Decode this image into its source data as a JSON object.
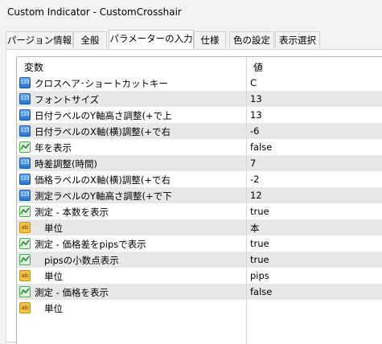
{
  "window": {
    "title": "Custom Indicator - CustomCrosshair"
  },
  "tabs": [
    {
      "label": "パージョン情報"
    },
    {
      "label": "全般"
    },
    {
      "label": "パラメーターの入力",
      "active": true
    },
    {
      "label": "仕様"
    },
    {
      "label": "色の設定"
    },
    {
      "label": "表示選択"
    }
  ],
  "grid": {
    "header_name": "変数",
    "header_value": "値",
    "rows": [
      {
        "type": "num",
        "name": "クロスヘア･ショートカットキー",
        "value": "C",
        "alt": false,
        "indent": false
      },
      {
        "type": "num",
        "name": "フォントサイズ",
        "value": "13",
        "alt": true,
        "indent": false
      },
      {
        "type": "num",
        "name": "日付ラベルのY軸高さ調整(+で上",
        "value": "13",
        "alt": false,
        "indent": false
      },
      {
        "type": "num",
        "name": "日付ラベルのX軸(横)調整(+で右",
        "value": "-6",
        "alt": true,
        "indent": false
      },
      {
        "type": "bool",
        "name": "年を表示",
        "value": "false",
        "alt": false,
        "indent": false
      },
      {
        "type": "num",
        "name": "時差調整(時間)",
        "value": "7",
        "alt": true,
        "indent": false
      },
      {
        "type": "num",
        "name": "価格ラベルのX軸(横)調整(+で右",
        "value": "-2",
        "alt": false,
        "indent": false
      },
      {
        "type": "num",
        "name": "測定ラベルのY軸高さ調整(+で下",
        "value": "12",
        "alt": true,
        "indent": false
      },
      {
        "type": "bool",
        "name": "測定 - 本数を表示",
        "value": "true",
        "alt": false,
        "indent": false
      },
      {
        "type": "str",
        "name": "単位",
        "value": "本",
        "alt": true,
        "indent": true
      },
      {
        "type": "bool",
        "name": "測定 - 価格差をpipsで表示",
        "value": "true",
        "alt": false,
        "indent": false
      },
      {
        "type": "bool",
        "name": "pipsの小数点表示",
        "value": "true",
        "alt": true,
        "indent": true
      },
      {
        "type": "str",
        "name": "単位",
        "value": "pips",
        "alt": false,
        "indent": true
      },
      {
        "type": "bool",
        "name": "測定 - 価格を表示",
        "value": "false",
        "alt": true,
        "indent": false
      },
      {
        "type": "str",
        "name": "単位",
        "value": "",
        "alt": false,
        "indent": true
      }
    ]
  },
  "icons": {
    "num": "number-type-icon",
    "bool": "boolean-type-icon",
    "str": "string-type-icon"
  },
  "icon_text": {
    "num": "123",
    "str": "ab"
  }
}
